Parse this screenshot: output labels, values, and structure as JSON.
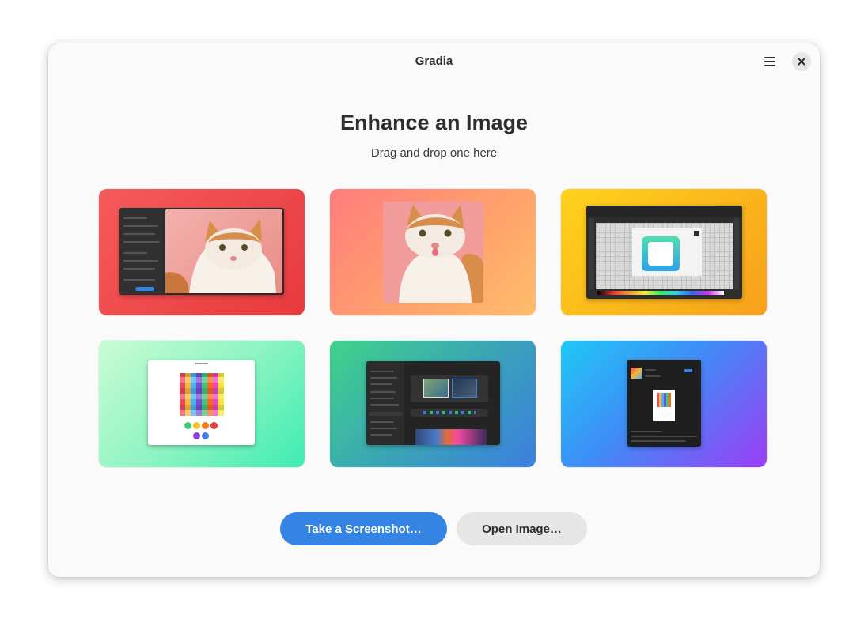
{
  "window": {
    "title": "Gradia"
  },
  "icons": {
    "menu": "hamburger-menu-icon",
    "close": "close-icon"
  },
  "hero": {
    "title": "Enhance an Image",
    "subtitle": "Drag and drop one here"
  },
  "examples": [
    {
      "name": "example-cat-editor",
      "content": "Gradia editor with cat photo"
    },
    {
      "name": "example-cat-photo",
      "content": "Cat photo"
    },
    {
      "name": "example-image-editor",
      "content": "Image editor canvas"
    },
    {
      "name": "example-color-grid-app",
      "content": "Color grid app"
    },
    {
      "name": "example-settings-appearance",
      "content": "Settings appearance panel"
    },
    {
      "name": "example-store-page",
      "content": "App store page"
    }
  ],
  "actions": {
    "screenshot_label": "Take a Screenshot…",
    "open_label": "Open Image…"
  },
  "colors": {
    "accent": "#3584e4",
    "window_bg": "#fafafa",
    "secondary_button": "#e6e6e6"
  }
}
